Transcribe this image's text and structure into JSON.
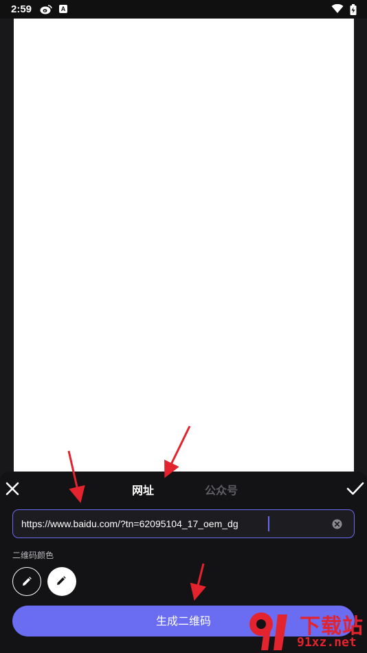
{
  "status_bar": {
    "time": "2:59",
    "icons": [
      "weibo-icon",
      "a-badge-icon",
      "wifi-icon",
      "battery-icon"
    ],
    "a_badge": "A"
  },
  "header": {
    "tabs": [
      {
        "label": "网址",
        "active": true
      },
      {
        "label": "公众号",
        "active": false
      }
    ],
    "close_icon": "close-icon",
    "confirm_icon": "check-icon"
  },
  "url_input": {
    "value": "https://www.baidu.com/?tn=62095104_17_oem_dg"
  },
  "color_section": {
    "label": "二维码颜色",
    "swatches": [
      {
        "name": "foreground",
        "color": "#131315"
      },
      {
        "name": "background",
        "color": "#ffffff"
      }
    ]
  },
  "generate_button": {
    "label": "生成二维码"
  },
  "watermark": {
    "text_cn": "下载站",
    "url": "91xz.net"
  },
  "colors": {
    "accent": "#6a6cf2",
    "panel": "#131315",
    "annotation": "#e3232d"
  }
}
